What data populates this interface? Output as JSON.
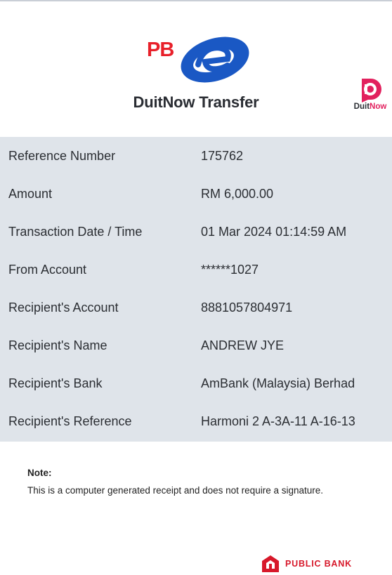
{
  "header": {
    "brand": "PBe",
    "title": "DuitNow Transfer",
    "duitnow_part1": "Duit",
    "duitnow_part2": "Now"
  },
  "details": [
    {
      "label": "Reference Number",
      "value": "175762"
    },
    {
      "label": "Amount",
      "value": "RM 6,000.00"
    },
    {
      "label": "Transaction Date / Time",
      "value": "01 Mar 2024 01:14:59 AM"
    },
    {
      "label": "From Account",
      "value": "******1027"
    },
    {
      "label": "Recipient's Account",
      "value": "8881057804971"
    },
    {
      "label": "Recipient's Name",
      "value": "ANDREW JYE"
    },
    {
      "label": "Recipient's Bank",
      "value": "AmBank (Malaysia) Berhad"
    },
    {
      "label": "Recipient's Reference",
      "value": "Harmoni 2 A-3A-11 A-16-13"
    }
  ],
  "note": {
    "title": "Note:",
    "text": "This is a computer generated receipt and does not require a signature."
  },
  "footer": {
    "bank_name": "PUBLIC BANK"
  },
  "colors": {
    "pbe_red": "#e8202a",
    "pbe_blue": "#1a58c4",
    "duitnow_pink": "#e2215e",
    "details_bg": "#dfe4ea",
    "public_bank_red": "#d7182a"
  },
  "icons": [
    "pbe-logo",
    "duitnow-logo-icon",
    "public-bank-logo-icon"
  ]
}
